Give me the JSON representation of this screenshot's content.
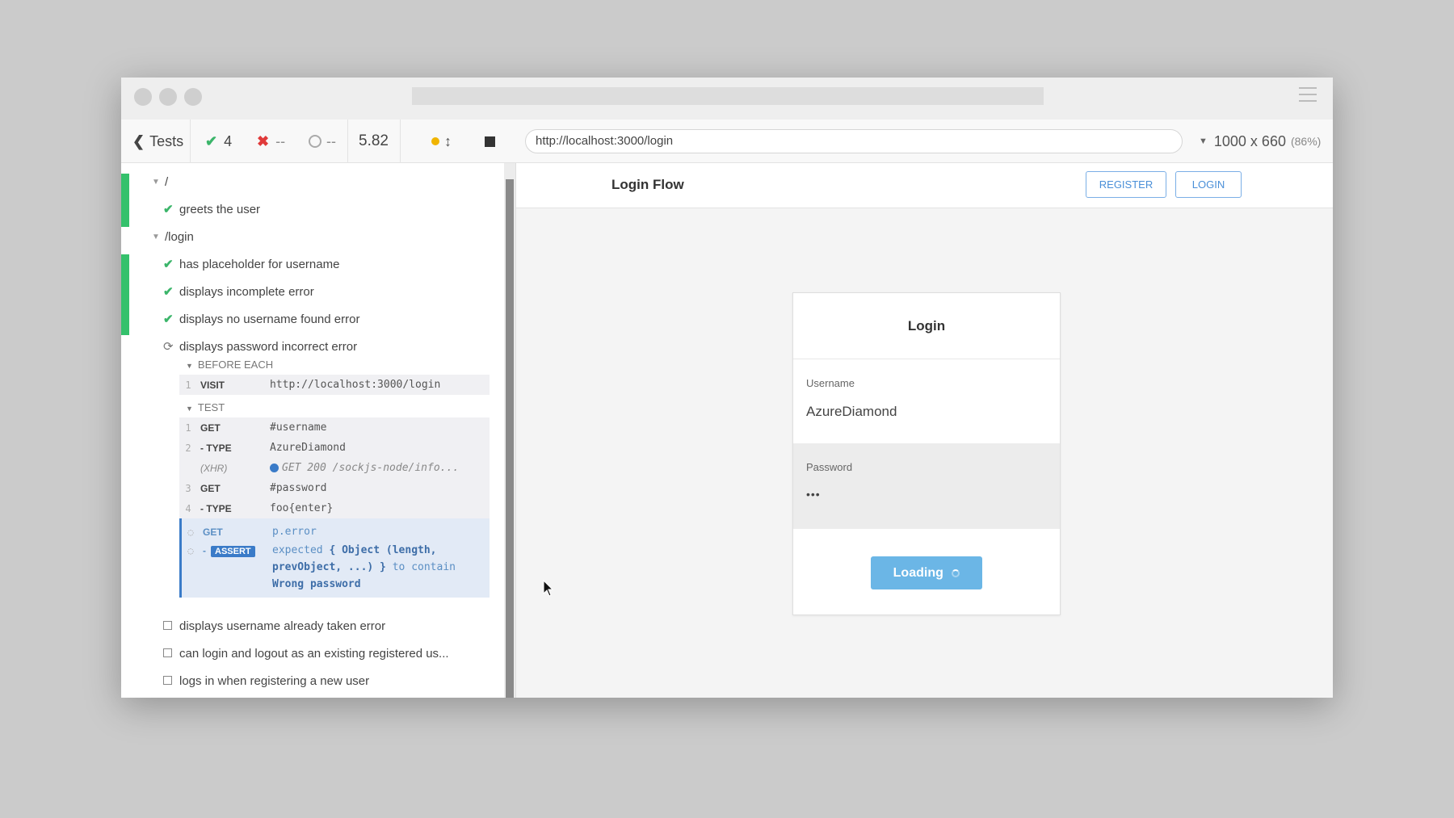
{
  "toolbar": {
    "tests_label": "Tests",
    "passed": "4",
    "failed": "--",
    "pending": "--",
    "duration": "5.82",
    "url": "http://localhost:3000/login",
    "viewport": "1000 x 660",
    "scale": "(86%)"
  },
  "reporter": {
    "suite_root": "/",
    "test_greets": "greets the user",
    "suite_login": "/login",
    "test_placeholder": "has placeholder for username",
    "test_incomplete": "displays incomplete error",
    "test_nouser": "displays no username found error",
    "test_password": "displays password incorrect error",
    "hook_before": "BEFORE EACH",
    "hook_test": "TEST",
    "before_cmd": {
      "num": "1",
      "name": "VISIT",
      "msg": "http://localhost:3000/login"
    },
    "commands": [
      {
        "num": "1",
        "name": "GET",
        "msg": "#username"
      },
      {
        "num": "2",
        "name": "- TYPE",
        "msg": "AzureDiamond"
      },
      {
        "num": "",
        "name": "(XHR)",
        "msg": "GET 200 /sockjs-node/info..."
      },
      {
        "num": "3",
        "name": "GET",
        "msg": "#password"
      },
      {
        "num": "4",
        "name": "- TYPE",
        "msg": "foo{enter}"
      },
      {
        "num": "",
        "name": "GET",
        "msg": "p.error"
      }
    ],
    "assert": {
      "dash": "-",
      "badge": "ASSERT",
      "line1_a": "expected",
      "line1_b": "{ Object (length,",
      "line2_a": "prevObject, ...) }",
      "line2_b": "to contain",
      "line3": "Wrong password"
    },
    "test_taken": "displays username already taken error",
    "test_logout": "can login and logout as an existing registered us...",
    "test_register": "logs in when registering a new user"
  },
  "app": {
    "brand": "Login Flow",
    "register": "REGISTER",
    "login": "LOGIN",
    "card_title": "Login",
    "username_label": "Username",
    "username_value": "AzureDiamond",
    "password_label": "Password",
    "password_value": "•••",
    "button_label": "Loading"
  },
  "colors": {
    "pass": "#35c16c",
    "fail": "#e03a3a",
    "accent": "#3a7bc8",
    "button": "#6bb6e6"
  }
}
